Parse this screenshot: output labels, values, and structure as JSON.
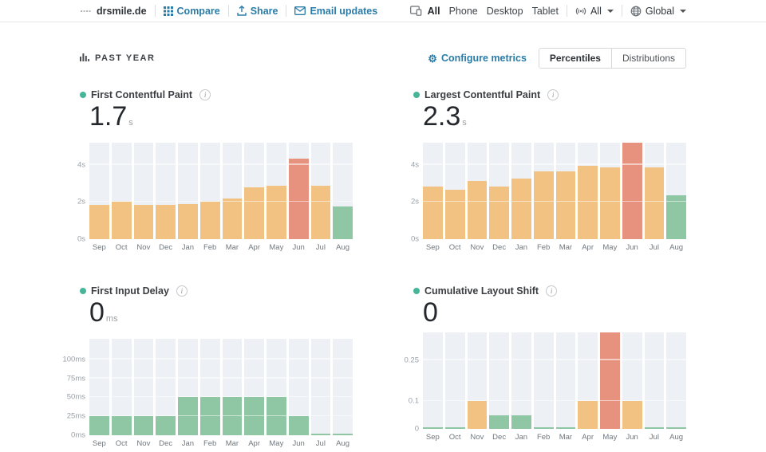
{
  "colors": {
    "good": "#8fc7a4",
    "needs_improvement": "#f2c283",
    "poor": "#e6927e",
    "column_bg": "#edf0f4",
    "accent_link": "#2a7ca8",
    "metric_dot": "#46b598"
  },
  "icons": {
    "logo": "site-logo-mark",
    "compare": "grid-icon",
    "share": "arrow-up-tray-icon",
    "email": "envelope-icon",
    "devices": "tablet-phone-icon",
    "connection": "signal-waves-icon",
    "region": "globe-icon",
    "period": "bar-chart-icon",
    "configure": "gear-icon",
    "info": "i-circle-icon",
    "caret": "chevron-down-icon"
  },
  "header": {
    "site_name": "drsmile.de",
    "nav": {
      "compare": "Compare",
      "share": "Share",
      "email_updates": "Email updates"
    },
    "device_tabs": {
      "items": [
        "All",
        "Phone",
        "Desktop",
        "Tablet"
      ],
      "selected": "All"
    },
    "connection": {
      "value": "All"
    },
    "region": {
      "value": "Global"
    }
  },
  "toolbar": {
    "period": "PAST YEAR",
    "configure": "Configure metrics",
    "views": {
      "items": [
        "Percentiles",
        "Distributions"
      ],
      "selected": "Percentiles"
    }
  },
  "months": [
    "Sep",
    "Oct",
    "Nov",
    "Dec",
    "Jan",
    "Feb",
    "Mar",
    "Apr",
    "May",
    "Jun",
    "Jul",
    "Aug"
  ],
  "charts": [
    {
      "title": "First Contentful Paint",
      "value": "1.7",
      "unit": "s",
      "chart_data": {
        "type": "bar",
        "categories": [
          "Sep",
          "Oct",
          "Nov",
          "Dec",
          "Jan",
          "Feb",
          "Mar",
          "Apr",
          "May",
          "Jun",
          "Jul",
          "Aug"
        ],
        "values": [
          1.85,
          2.0,
          1.85,
          1.85,
          1.9,
          2.0,
          2.2,
          2.8,
          2.9,
          4.35,
          2.9,
          1.75
        ],
        "ratings": [
          "ni",
          "ni",
          "ni",
          "ni",
          "ni",
          "ni",
          "ni",
          "ni",
          "ni",
          "poor",
          "ni",
          "good"
        ],
        "ylim": [
          0,
          5.2
        ],
        "ticks": [
          {
            "value": 0,
            "label": "0s"
          },
          {
            "value": 2,
            "label": "2s"
          },
          {
            "value": 4,
            "label": "4s"
          }
        ]
      }
    },
    {
      "title": "Largest Contentful Paint",
      "value": "2.3",
      "unit": "s",
      "chart_data": {
        "type": "bar",
        "categories": [
          "Sep",
          "Oct",
          "Nov",
          "Dec",
          "Jan",
          "Feb",
          "Mar",
          "Apr",
          "May",
          "Jun",
          "Jul",
          "Aug"
        ],
        "values": [
          2.85,
          2.65,
          3.15,
          2.85,
          3.25,
          3.65,
          3.65,
          3.95,
          3.85,
          5.2,
          3.85,
          2.35
        ],
        "ratings": [
          "ni",
          "ni",
          "ni",
          "ni",
          "ni",
          "ni",
          "ni",
          "ni",
          "ni",
          "poor",
          "ni",
          "good"
        ],
        "ylim": [
          0,
          5.2
        ],
        "ticks": [
          {
            "value": 0,
            "label": "0s"
          },
          {
            "value": 2,
            "label": "2s"
          },
          {
            "value": 4,
            "label": "4s"
          }
        ]
      }
    },
    {
      "title": "First Input Delay",
      "value": "0",
      "unit": "ms",
      "chart_data": {
        "type": "bar",
        "categories": [
          "Sep",
          "Oct",
          "Nov",
          "Dec",
          "Jan",
          "Feb",
          "Mar",
          "Apr",
          "May",
          "Jun",
          "Jul",
          "Aug"
        ],
        "values": [
          25,
          25,
          25,
          25,
          50,
          50,
          50,
          50,
          50,
          25,
          1,
          1
        ],
        "ratings": [
          "good",
          "good",
          "good",
          "good",
          "good",
          "good",
          "good",
          "good",
          "good",
          "good",
          "good",
          "good"
        ],
        "ylim": [
          0,
          127
        ],
        "ticks": [
          {
            "value": 0,
            "label": "0ms"
          },
          {
            "value": 25,
            "label": "25ms"
          },
          {
            "value": 50,
            "label": "50ms"
          },
          {
            "value": 75,
            "label": "75ms"
          },
          {
            "value": 100,
            "label": "100ms"
          }
        ]
      }
    },
    {
      "title": "Cumulative Layout Shift",
      "value": "0",
      "unit": "",
      "chart_data": {
        "type": "bar",
        "categories": [
          "Sep",
          "Oct",
          "Nov",
          "Dec",
          "Jan",
          "Feb",
          "Mar",
          "Apr",
          "May",
          "Jun",
          "Jul",
          "Aug"
        ],
        "values": [
          0.005,
          0.005,
          0.1,
          0.05,
          0.05,
          0.005,
          0.005,
          0.1,
          0.35,
          0.1,
          0.005,
          0.005
        ],
        "ratings": [
          "good",
          "good",
          "ni",
          "good",
          "good",
          "good",
          "good",
          "ni",
          "poor",
          "ni",
          "good",
          "good"
        ],
        "ylim": [
          0,
          0.35
        ],
        "ticks": [
          {
            "value": 0,
            "label": "0"
          },
          {
            "value": 0.1,
            "label": "0.1"
          },
          {
            "value": 0.25,
            "label": "0.25"
          }
        ]
      }
    }
  ]
}
